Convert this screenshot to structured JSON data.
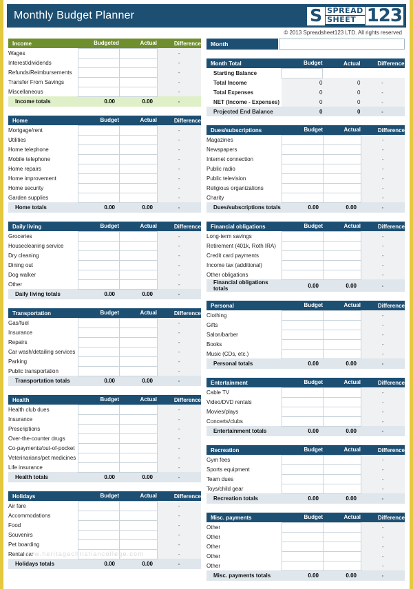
{
  "header": {
    "app_title": "Monthly Budget Planner",
    "logo_mark": "S",
    "logo_line1": "SPREAD",
    "logo_line2": "SHEET",
    "logo_number": "123",
    "copyright": "© 2013 Spreadsheet123 LTD. All rights reserved"
  },
  "watermark": "www.heritagechristiancollege.com",
  "month": {
    "label": "Month",
    "value": "",
    "placeholder": ""
  },
  "columns": {
    "budgeted": "Budgeted",
    "budget": "Budget",
    "actual": "Actual",
    "difference": "Difference"
  },
  "dash": "-",
  "zero_two": "0.00",
  "zero": "0",
  "income": {
    "title": "Income",
    "headers": [
      "Budgeted",
      "Actual",
      "Difference"
    ],
    "items": [
      "Wages",
      "Interest/dividends",
      "Refunds/Reimbursements",
      "Transfer From Savings",
      "Miscellaneous"
    ],
    "totals_label": "Income totals",
    "totals_budget": "0.00",
    "totals_actual": "0.00",
    "totals_diff": "-"
  },
  "month_total": {
    "title": "Month Total",
    "headers": [
      "Budget",
      "Actual",
      "Difference"
    ],
    "rows": [
      {
        "label": "Starting Balance",
        "budget": "",
        "actual": "",
        "diff": "",
        "editable": true
      },
      {
        "label": "Total Income",
        "budget": "0",
        "actual": "0",
        "diff": "-",
        "editable": false
      },
      {
        "label": "Total Expenses",
        "budget": "0",
        "actual": "0",
        "diff": "-",
        "editable": false
      },
      {
        "label": "NET (Income - Expenses)",
        "budget": "0",
        "actual": "0",
        "diff": "-",
        "editable": false
      },
      {
        "label": "Projected End Balance",
        "budget": "0",
        "actual": "0",
        "diff": "-",
        "editable": false
      }
    ]
  },
  "sections_left": [
    {
      "title": "Home",
      "items": [
        "Mortgage/rent",
        "Utilities",
        "Home telephone",
        "Mobile telephone",
        "Home repairs",
        "Home improvement",
        "Home security",
        "Garden supplies"
      ],
      "totals_label": "Home totals",
      "totals_budget": "0.00",
      "totals_actual": "0.00",
      "totals_diff": "-"
    },
    {
      "title": "Daily living",
      "items": [
        "Groceries",
        "Housecleaning service",
        "Dry cleaning",
        "Dining out",
        "Dog walker",
        "Other"
      ],
      "totals_label": "Daily living totals",
      "totals_budget": "0.00",
      "totals_actual": "0.00",
      "totals_diff": "-"
    },
    {
      "title": "Transportation",
      "items": [
        "Gas/fuel",
        "Insurance",
        "Repairs",
        "Car wash/detailing services",
        "Parking",
        "Public transportation"
      ],
      "totals_label": "Transportation totals",
      "totals_budget": "0.00",
      "totals_actual": "0.00",
      "totals_diff": "-"
    },
    {
      "title": "Health",
      "items": [
        "Health club dues",
        "Insurance",
        "Prescriptions",
        "Over-the-counter drugs",
        "Co-payments/out-of-pocket",
        "Veterinarians/pet medicines",
        "Life insurance"
      ],
      "totals_label": "Health totals",
      "totals_budget": "0.00",
      "totals_actual": "0.00",
      "totals_diff": "-"
    },
    {
      "title": "Holidays",
      "items": [
        "Air fare",
        "Accommodations",
        "Food",
        "Souvenirs",
        "Pet boarding",
        "Rental car"
      ],
      "totals_label": "Holidays totals",
      "totals_budget": "0.00",
      "totals_actual": "0.00",
      "totals_diff": "-"
    }
  ],
  "sections_right": [
    {
      "title": "Dues/subscriptions",
      "items": [
        "Magazines",
        "Newspapers",
        "Internet connection",
        "Public radio",
        "Public television",
        "Religious organizations",
        "Charity"
      ],
      "totals_label": "Dues/subscriptions totals",
      "totals_budget": "0.00",
      "totals_actual": "0.00",
      "totals_diff": "-"
    },
    {
      "title": "Financial obligations",
      "items": [
        "Long-term savings",
        "Retirement (401k, Roth IRA)",
        "Credit card payments",
        "Income tax (additional)",
        "Other obligations"
      ],
      "totals_label": "Financial obligations totals",
      "totals_budget": "0.00",
      "totals_actual": "0.00",
      "totals_diff": "-"
    },
    {
      "title": "Personal",
      "items": [
        "Clothing",
        "Gifts",
        "Salon/barber",
        "Books",
        "Music (CDs, etc.)"
      ],
      "totals_label": "Personal totals",
      "totals_budget": "0.00",
      "totals_actual": "0.00",
      "totals_diff": "-"
    },
    {
      "title": "Entertainment",
      "items": [
        "Cable TV",
        "Video/DVD rentals",
        "Movies/plays",
        "Concerts/clubs"
      ],
      "totals_label": "Entertainment totals",
      "totals_budget": "0.00",
      "totals_actual": "0.00",
      "totals_diff": "-"
    },
    {
      "title": "Recreation",
      "items": [
        "Gym fees",
        "Sports equipment",
        "Team dues",
        "Toys/child gear"
      ],
      "totals_label": "Recreation totals",
      "totals_budget": "0.00",
      "totals_actual": "0.00",
      "totals_diff": "-"
    },
    {
      "title": "Misc. payments",
      "items": [
        "Other",
        "Other",
        "Other",
        "Other",
        "Other"
      ],
      "totals_label": "Misc. payments totals",
      "totals_budget": "0.00",
      "totals_actual": "0.00",
      "totals_diff": "-"
    }
  ],
  "colors": {
    "header_blue": "#1d4f73",
    "income_green": "#6f8e2d",
    "border_gold": "#e3c93b",
    "totals_blue": "#dfe6ec",
    "totals_green": "#dff0c8"
  }
}
